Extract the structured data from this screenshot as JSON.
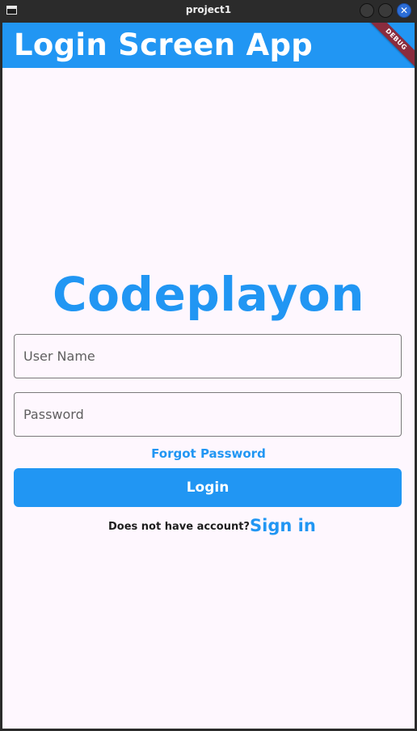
{
  "window": {
    "title": "project1"
  },
  "appbar": {
    "title": "Login Screen App",
    "debug_label": "DEBUG"
  },
  "brand": {
    "text": "Codeplayon"
  },
  "form": {
    "username_placeholder": "User Name",
    "username_value": "",
    "password_placeholder": "Password",
    "password_value": "",
    "forgot_label": "Forgot Password",
    "login_label": "Login",
    "signup_prompt": "Does not have account?",
    "signin_label": "Sign in"
  },
  "colors": {
    "primary": "#2196f3",
    "background": "#fef7fe",
    "debug_banner": "#8a2c3e"
  },
  "icons": {
    "window_icon": "window-icon",
    "minimize": "minimize-icon",
    "maximize": "maximize-icon",
    "close": "close-icon"
  }
}
